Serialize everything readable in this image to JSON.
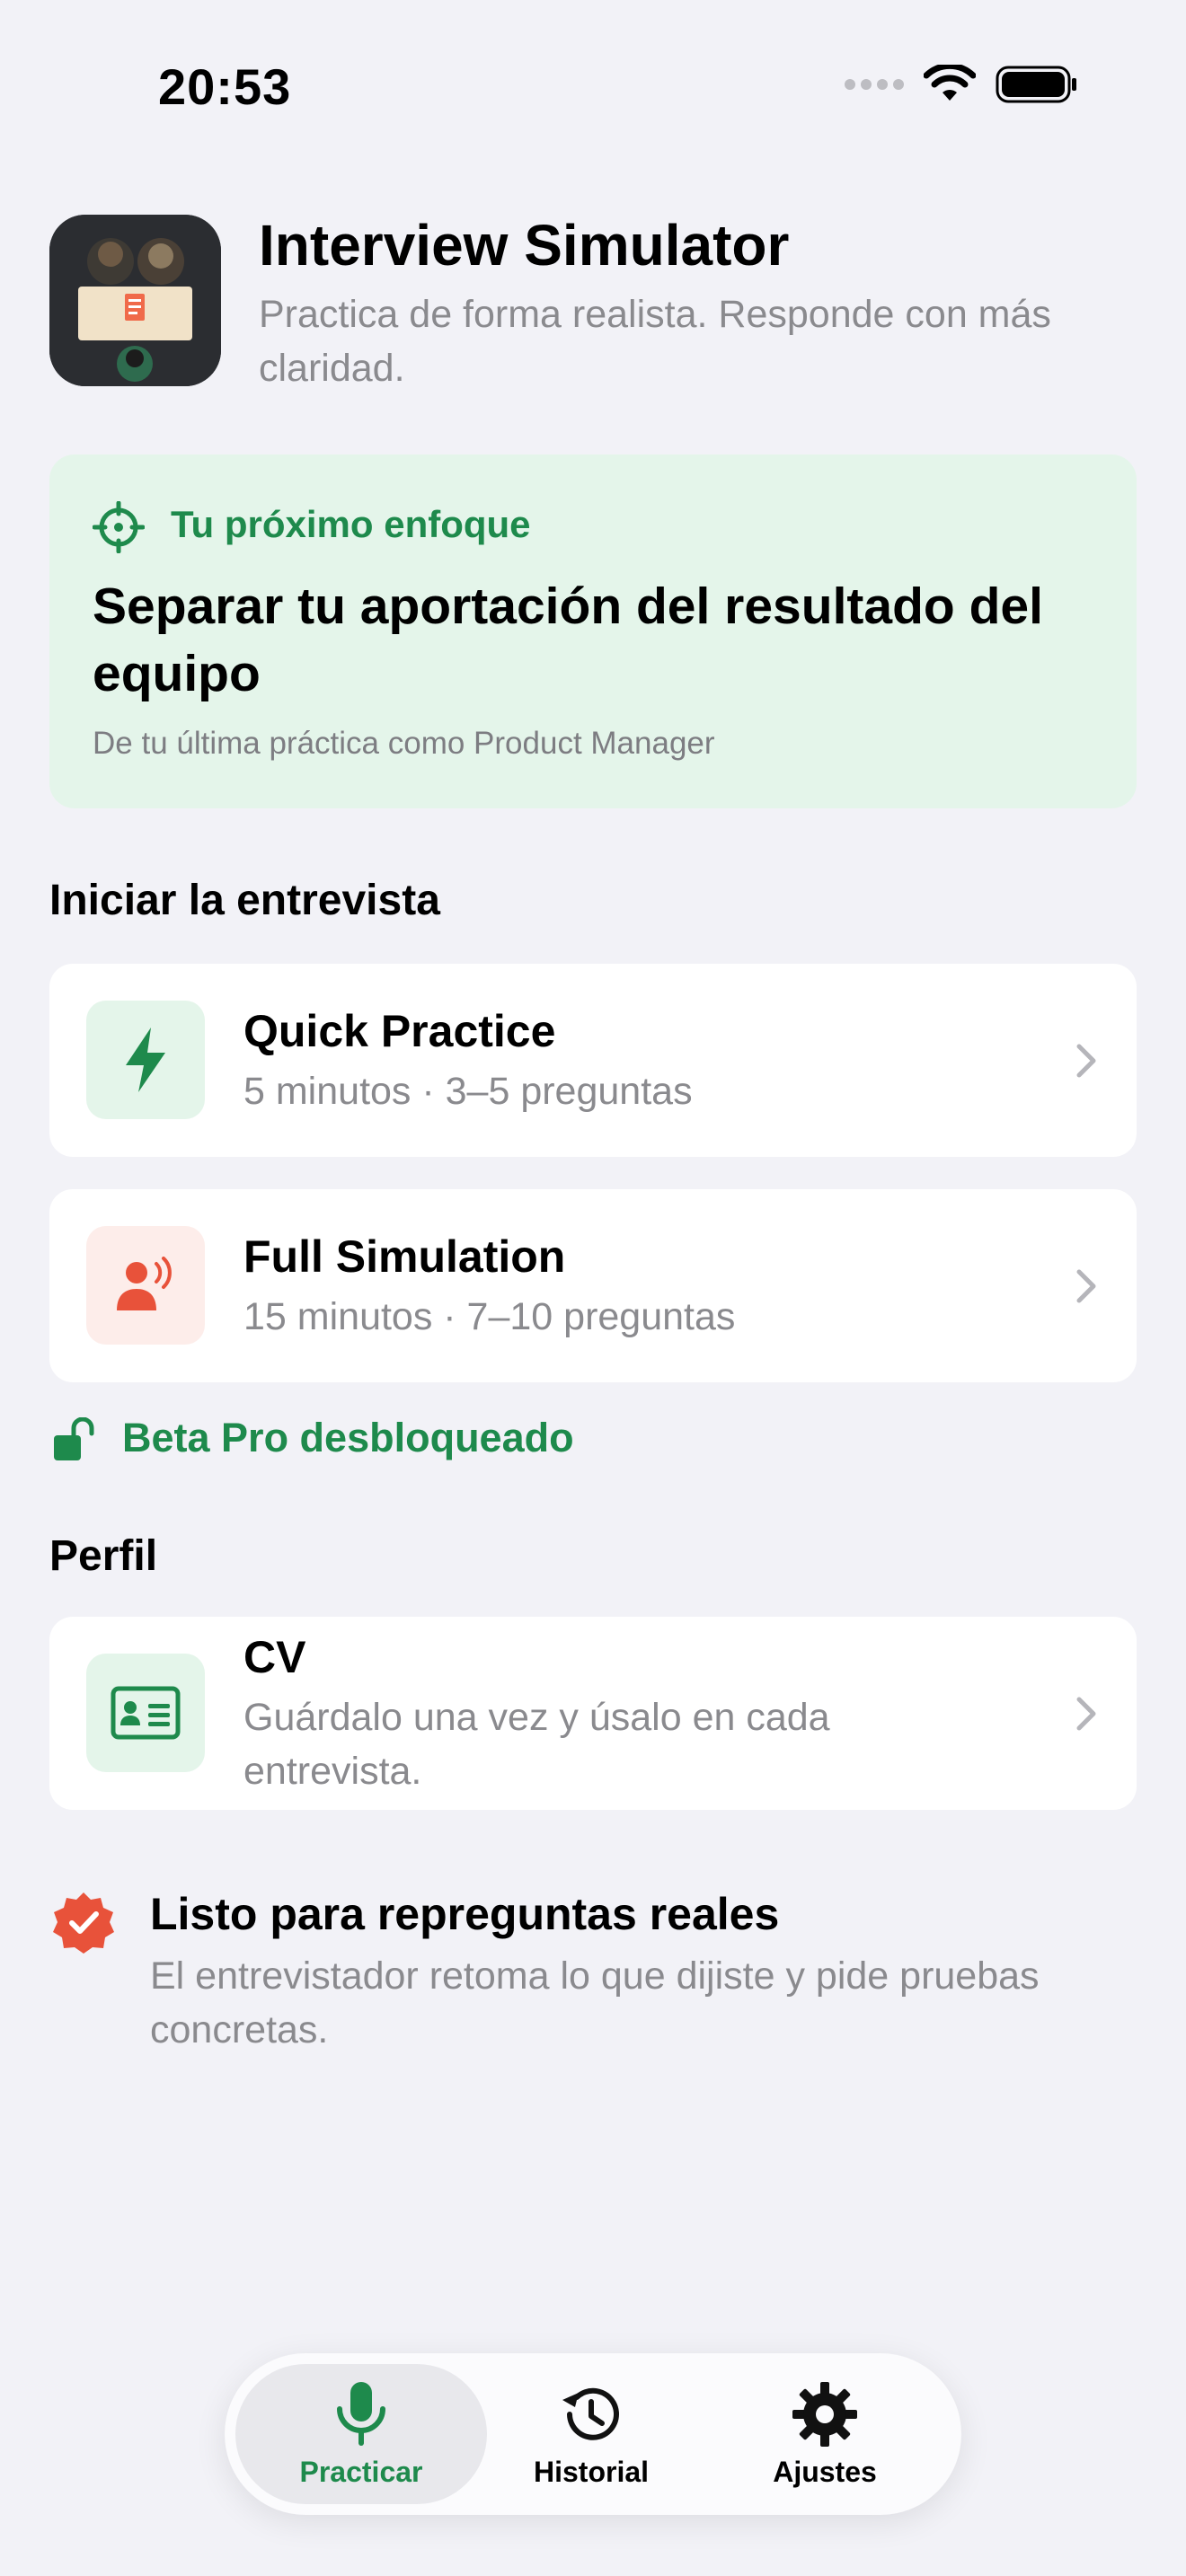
{
  "status_bar": {
    "time": "20:53"
  },
  "header": {
    "title": "Interview Simulator",
    "subtitle": "Practica de forma realista. Responde con más claridad."
  },
  "focus": {
    "label": "Tu próximo enfoque",
    "title": "Separar tu aportación del resultado del equipo",
    "note": "De tu última práctica como Product Manager"
  },
  "start_section": {
    "heading": "Iniciar la entrevista",
    "options": [
      {
        "title": "Quick Practice",
        "subtitle": "5 minutos · 3–5 preguntas"
      },
      {
        "title": "Full Simulation",
        "subtitle": "15 minutos · 7–10 preguntas"
      }
    ],
    "pro_status": "Beta Pro desbloqueado"
  },
  "profile_section": {
    "heading": "Perfil",
    "cv": {
      "title": "CV",
      "subtitle": "Guárdalo una vez y úsalo en cada entrevista."
    }
  },
  "ready": {
    "title": "Listo para repreguntas reales",
    "subtitle": "El entrevistador retoma lo que dijiste y pide pruebas concretas."
  },
  "tabbar": {
    "tabs": [
      {
        "label": "Practicar",
        "icon": "microphone-icon",
        "active": true
      },
      {
        "label": "Historial",
        "icon": "history-icon",
        "active": false
      },
      {
        "label": "Ajustes",
        "icon": "gear-icon",
        "active": false
      }
    ]
  },
  "colors": {
    "accent_green": "#1E8A4C",
    "accent_orange": "#E8523A",
    "background": "#F2F2F7",
    "focus_card": "#E4F5EA"
  }
}
